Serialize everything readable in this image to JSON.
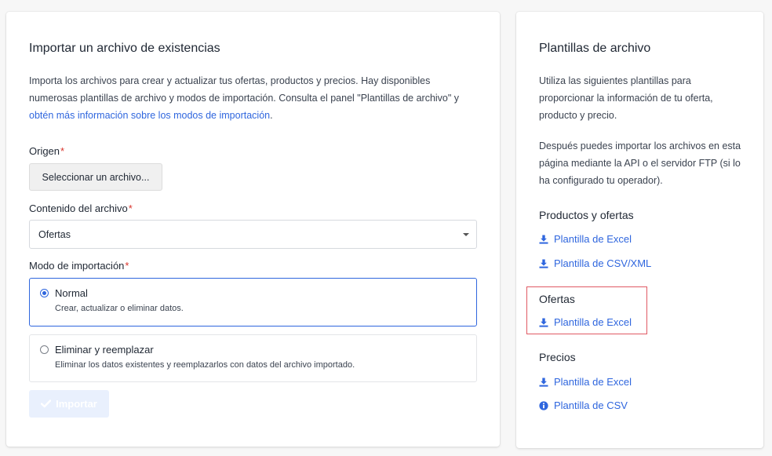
{
  "import": {
    "title": "Importar un archivo de existencias",
    "description_text": "Importa los archivos para crear y actualizar tus ofertas, productos y precios. Hay disponibles numerosas plantillas de archivo y modos de importación. Consulta el panel \"Plantillas de archivo\" y ",
    "description_link": "obtén más información sobre los modos de importación",
    "description_end": ".",
    "origin_label": "Origen",
    "required_mark": "*",
    "file_button_label": "Seleccionar un archivo...",
    "content_label": "Contenido del archivo",
    "content_value": "Ofertas",
    "mode_label": "Modo de importación",
    "modes": [
      {
        "label": "Normal",
        "description": "Crear, actualizar o eliminar datos.",
        "selected": true
      },
      {
        "label": "Eliminar y reemplazar",
        "description": "Eliminar los datos existentes y reemplazarlos con datos del archivo importado.",
        "selected": false
      }
    ],
    "import_button_label": "Importar"
  },
  "templates": {
    "title": "Plantillas de archivo",
    "intro": "Utiliza las siguientes plantillas para proporcionar la información de tu oferta, producto y precio.",
    "intro2": "Después puedes importar los archivos en esta página mediante la API o el servidor FTP (si lo ha configurado tu operador).",
    "sections": [
      {
        "title": "Productos y ofertas",
        "links": [
          "Plantilla de Excel",
          "Plantilla de CSV/XML"
        ]
      },
      {
        "title": "Ofertas",
        "links": [
          "Plantilla de Excel"
        ]
      },
      {
        "title": "Precios",
        "links": [
          "Plantilla de Excel",
          "Plantilla de CSV"
        ]
      }
    ]
  },
  "colors": {
    "accent": "#2f66de",
    "required": "#d9342b",
    "highlight": "#e05a64"
  }
}
